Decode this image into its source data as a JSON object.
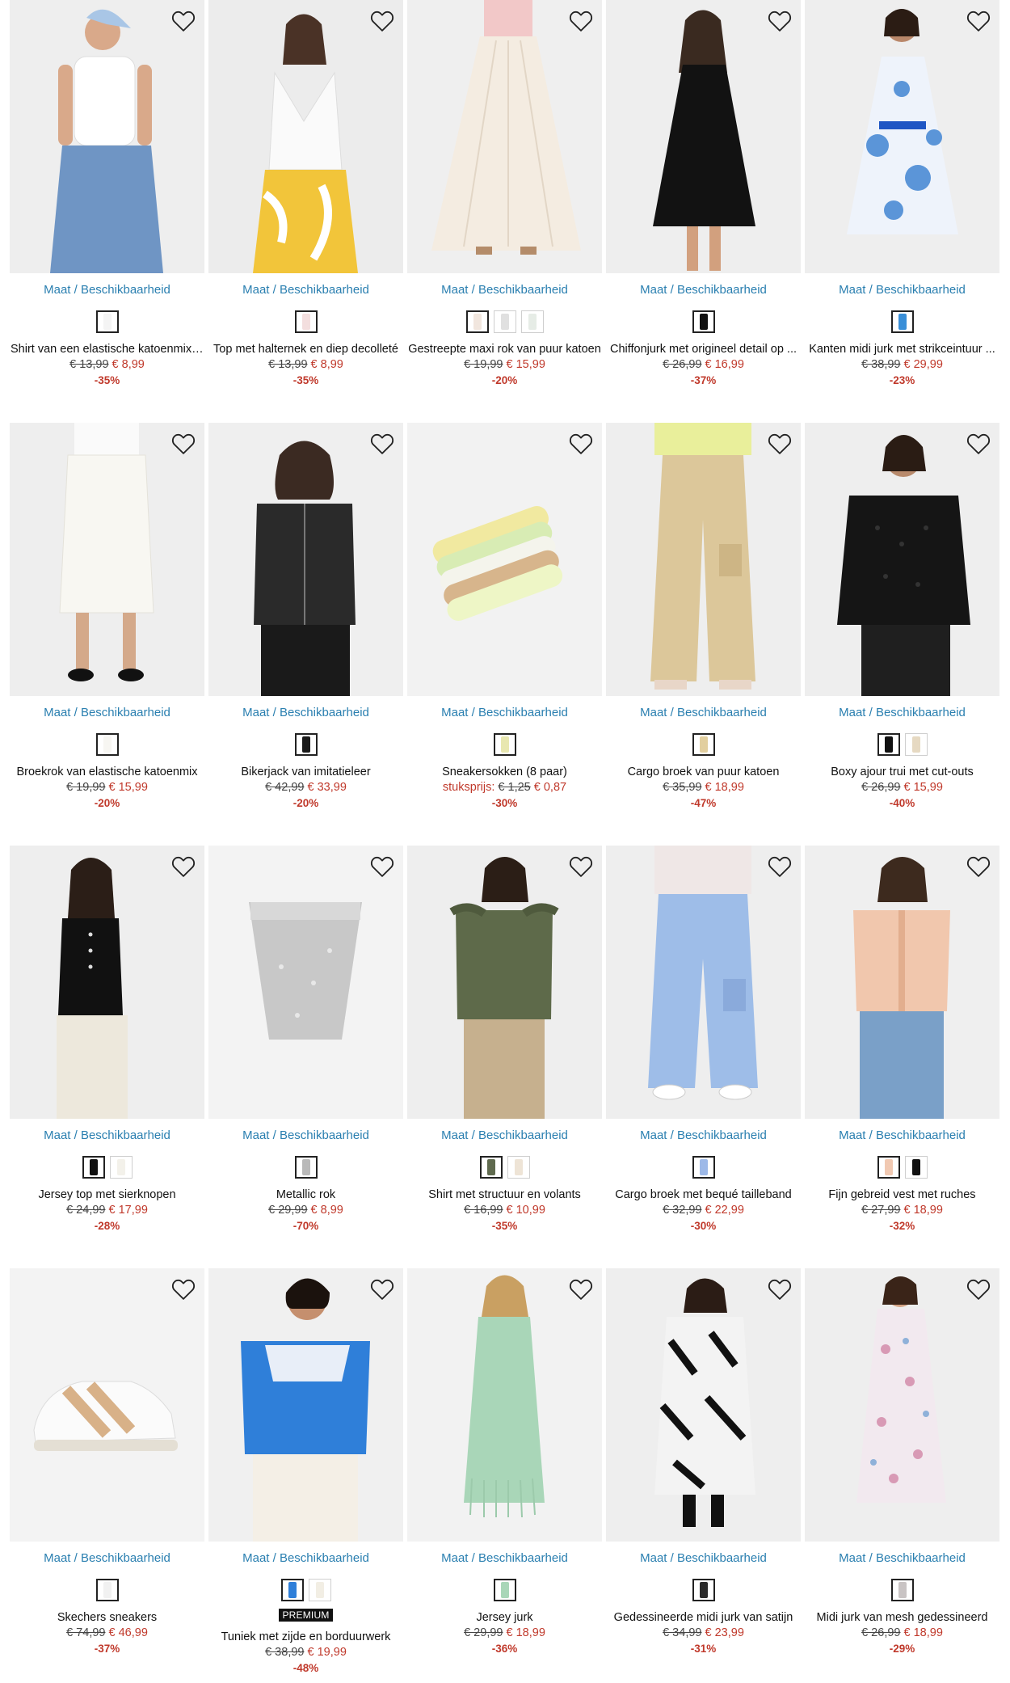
{
  "common": {
    "maat_label": "Maat / Beschikbaarheid"
  },
  "products": [
    {
      "title": "Shirt van een elastische katoenmix ...",
      "old_price": "€ 13,99",
      "new_price": "€ 8,99",
      "discount": "-35%",
      "unit_label": "",
      "premium": "",
      "swatches": [
        "#f4f4f4"
      ],
      "art": "top-jeans"
    },
    {
      "title": "Top met halternek en diep decolleté",
      "old_price": "€ 13,99",
      "new_price": "€ 8,99",
      "discount": "-35%",
      "unit_label": "",
      "premium": "",
      "swatches": [
        "#f3dede"
      ],
      "art": "halter"
    },
    {
      "title": "Gestreepte maxi rok van puur katoen",
      "old_price": "€ 19,99",
      "new_price": "€ 15,99",
      "discount": "-20%",
      "unit_label": "",
      "premium": "",
      "swatches": [
        "#f1e6de",
        "#e0e0e0",
        "#e6ece6"
      ],
      "art": "maxiskirt"
    },
    {
      "title": "Chiffonjurk met origineel detail op ...",
      "old_price": "€ 26,99",
      "new_price": "€ 16,99",
      "discount": "-37%",
      "unit_label": "",
      "premium": "",
      "swatches": [
        "#111111"
      ],
      "art": "blackdress"
    },
    {
      "title": "Kanten midi jurk met strikceintuur ...",
      "old_price": "€ 38,99",
      "new_price": "€ 29,99",
      "discount": "-23%",
      "unit_label": "",
      "premium": "",
      "swatches": [
        "#3a8fd8"
      ],
      "art": "bluedress"
    },
    {
      "title": "Broekrok van elastische katoenmix",
      "old_price": "€ 19,99",
      "new_price": "€ 15,99",
      "discount": "-20%",
      "unit_label": "",
      "premium": "",
      "swatches": [
        "#f7f6f2"
      ],
      "art": "whiteskirt"
    },
    {
      "title": "Bikerjack van imitatieleer",
      "old_price": "€ 42,99",
      "new_price": "€ 33,99",
      "discount": "-20%",
      "unit_label": "",
      "premium": "",
      "swatches": [
        "#1a1a1a"
      ],
      "art": "jacket"
    },
    {
      "title": "Sneakersokken (8 paar)",
      "old_price": "€ 1,25",
      "new_price": "€ 0,87",
      "discount": "-30%",
      "unit_label": "stuksprijs:",
      "premium": "",
      "swatches": [
        "#e8e7b0"
      ],
      "art": "socks"
    },
    {
      "title": "Cargo broek van puur katoen",
      "old_price": "€ 35,99",
      "new_price": "€ 18,99",
      "discount": "-47%",
      "unit_label": "",
      "premium": "",
      "swatches": [
        "#e2cf9f"
      ],
      "art": "cargo-beige"
    },
    {
      "title": "Boxy ajour trui met cut-outs",
      "old_price": "€ 26,99",
      "new_price": "€ 15,99",
      "discount": "-40%",
      "unit_label": "",
      "premium": "",
      "swatches": [
        "#111111",
        "#e6d9c2"
      ],
      "art": "blacksweater"
    },
    {
      "title": "Jersey top met sierknopen",
      "old_price": "€ 24,99",
      "new_price": "€ 17,99",
      "discount": "-28%",
      "unit_label": "",
      "premium": "",
      "swatches": [
        "#111111",
        "#f3f1ea"
      ],
      "art": "blacktop"
    },
    {
      "title": "Metallic rok",
      "old_price": "€ 29,99",
      "new_price": "€ 8,99",
      "discount": "-70%",
      "unit_label": "",
      "premium": "",
      "swatches": [
        "#b9b9b9"
      ],
      "art": "metallic"
    },
    {
      "title": "Shirt met structuur en volants",
      "old_price": "€ 16,99",
      "new_price": "€ 10,99",
      "discount": "-35%",
      "unit_label": "",
      "premium": "",
      "swatches": [
        "#5f6a4e",
        "#eee4d6"
      ],
      "art": "olivetop"
    },
    {
      "title": "Cargo broek met bequé tailleband",
      "old_price": "€ 32,99",
      "new_price": "€ 22,99",
      "discount": "-30%",
      "unit_label": "",
      "premium": "",
      "swatches": [
        "#9db9e8"
      ],
      "art": "cargo-blue"
    },
    {
      "title": "Fijn gebreid vest met ruches",
      "old_price": "€ 27,99",
      "new_price": "€ 18,99",
      "discount": "-32%",
      "unit_label": "",
      "premium": "",
      "swatches": [
        "#f1c9b2",
        "#111111"
      ],
      "art": "cardigan"
    },
    {
      "title": "Skechers sneakers",
      "old_price": "€ 74,99",
      "new_price": "€ 46,99",
      "discount": "-37%",
      "unit_label": "",
      "premium": "",
      "swatches": [
        "#f1f1f1"
      ],
      "art": "sneaker"
    },
    {
      "title": "Tuniek met zijde en borduurwerk",
      "old_price": "€ 38,99",
      "new_price": "€ 19,99",
      "discount": "-48%",
      "unit_label": "",
      "premium": "PREMIUM",
      "swatches": [
        "#2f7fd9",
        "#f2eee4"
      ],
      "art": "tunic"
    },
    {
      "title": "Jersey jurk",
      "old_price": "€ 29,99",
      "new_price": "€ 18,99",
      "discount": "-36%",
      "unit_label": "",
      "premium": "",
      "swatches": [
        "#a9d6b8"
      ],
      "art": "greendress"
    },
    {
      "title": "Gedessineerde midi jurk van satijn",
      "old_price": "€ 34,99",
      "new_price": "€ 23,99",
      "discount": "-31%",
      "unit_label": "",
      "premium": "",
      "swatches": [
        "#2a2a2a"
      ],
      "art": "patterndress"
    },
    {
      "title": "Midi jurk van mesh gedessineerd",
      "old_price": "€ 26,99",
      "new_price": "€ 18,99",
      "discount": "-29%",
      "unit_label": "",
      "premium": "",
      "swatches": [
        "#c9c4c4"
      ],
      "art": "floraldress"
    }
  ],
  "colors": {
    "link": "#2a7fb0",
    "sale": "#c0392b",
    "strike": "#444444"
  }
}
